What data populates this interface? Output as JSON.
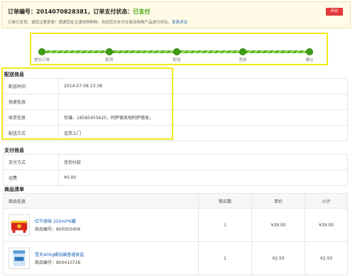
{
  "order": {
    "title_prefix": "订单编号：2014070828381，订单支付状态：",
    "status": "已支付",
    "notice": "订单已发货，请您注意查收！感谢您在主演快购购物，欢迎您对本次交易及购购产品进行评论。",
    "notice_link": "发表评论",
    "review_button": "评论"
  },
  "progress": {
    "steps": [
      "提交订单",
      "配货",
      "配送",
      "签收",
      "确认"
    ],
    "colors": {
      "track": "#57b51f",
      "dot": "#3f9e16"
    }
  },
  "delivery": {
    "title": "配送信息",
    "rows": [
      {
        "label": "配送时间",
        "value": "2014-07-08 23:38"
      },
      {
        "label": "快递信息",
        "value": ""
      },
      {
        "label": "收货信息",
        "value": "何谦，18585455625，阿萨德发地阿萨德发，"
      },
      {
        "label": "配送方式",
        "value": "送货上门"
      }
    ]
  },
  "payment": {
    "title": "支付信息",
    "rows": [
      {
        "label": "支付方式",
        "value": "货到付款"
      },
      {
        "label": "运费",
        "value": "¥0.00"
      }
    ]
  },
  "goods": {
    "title": "商品清单",
    "headers": [
      "商品信息",
      "购买数",
      "单价",
      "小计"
    ],
    "items": [
      {
        "name": "红牛原味 250ml*6罐",
        "code": "商品编号：800003406",
        "qty": "1",
        "price": "¥39.00",
        "subtotal": "¥39.00"
      },
      {
        "name": "雪天400g碘加碘普通食盐",
        "code": "商品编号：800410726",
        "qty": "1",
        "price": "¥2.50",
        "subtotal": "¥2.50"
      }
    ]
  },
  "colors": {
    "accent_red": "#e4393c",
    "status_green": "#3aa000",
    "highlight_yellow": "#f2ea1a",
    "link_blue": "#1660b8"
  }
}
